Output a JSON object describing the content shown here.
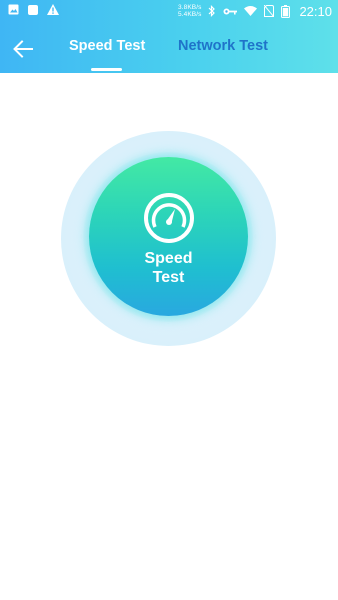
{
  "status_bar": {
    "net_up": "3.8KB/s",
    "net_down": "5.4KB/s",
    "time": "22:10",
    "icons": [
      "image-icon",
      "square-icon",
      "warning-icon",
      "bluetooth-icon",
      "key-icon",
      "wifi-icon",
      "no-sim-icon",
      "battery-icon"
    ]
  },
  "header": {
    "back_icon": "arrow-left-icon",
    "tabs": [
      {
        "label": "Speed Test",
        "active": true
      },
      {
        "label": "Network Test",
        "active": false
      }
    ]
  },
  "main": {
    "button_icon": "speedometer-icon",
    "button_line1": "Speed",
    "button_line2": "Test"
  },
  "colors": {
    "header_start": "#3fb6f4",
    "header_end": "#5ee0ea",
    "inactive_tab": "#1f73c9",
    "circle_top": "#43e9a4",
    "circle_bottom": "#29a8e0",
    "ring": "#d9f0fb"
  }
}
